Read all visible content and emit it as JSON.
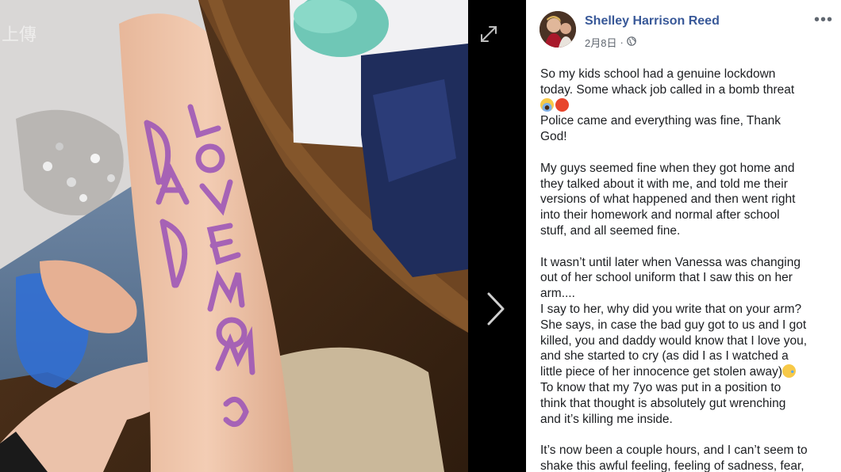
{
  "watermark": {
    "text": "上傳"
  },
  "viewer": {
    "expand_icon": "expand-icon",
    "next_icon": "chevron-right-icon"
  },
  "post": {
    "author": "Shelley Harrison Reed",
    "date": "2月8日",
    "separator": "·",
    "privacy_icon": "globe-icon",
    "more_label": "•••",
    "paragraphs": [
      {
        "lines": [
          "So my kids school had a genuine lockdown",
          "today. Some whack job called in a bomb threat",
          "",
          "Police came and everything was fine, Thank",
          "God!"
        ]
      },
      {
        "lines": [
          "My guys seemed fine when they got home and",
          "they talked about it with me, and told me their",
          "versions of what happened and then went right",
          "into their homework and normal after school",
          "stuff, and all seemed fine."
        ]
      },
      {
        "lines": [
          "It wasn’t until later when Vanessa was changing",
          "out of her school uniform that I saw this on her",
          "arm....",
          "I say to her, why did you write that on your arm?",
          "She says, in case the bad guy got to us and I got",
          "killed, you and daddy would know that I love you,",
          "and she started to cry (as did I as I watched a",
          "little piece of her innocence get stolen away)",
          "To know that my 7yo was put in a position to",
          "think that thought is absolutely gut wrenching",
          "and it’s killing me inside."
        ]
      },
      {
        "lines": [
          "It’s now been a couple hours, and I can’t seem to",
          "shake this awful feeling, feeling of sadness, fear,"
        ]
      }
    ],
    "emojis": {
      "p0_l2": [
        "scream-emoji",
        "angry-emoji"
      ],
      "p2_l7": [
        "sad-emoji"
      ]
    }
  },
  "photo": {
    "arm_text_1": "LOVE MOM",
    "arm_text_2": "DAD"
  },
  "colors": {
    "author_link": "#385898",
    "meta_text": "#606770",
    "body_text": "#1c1e21",
    "ink": "#9a52b8"
  }
}
